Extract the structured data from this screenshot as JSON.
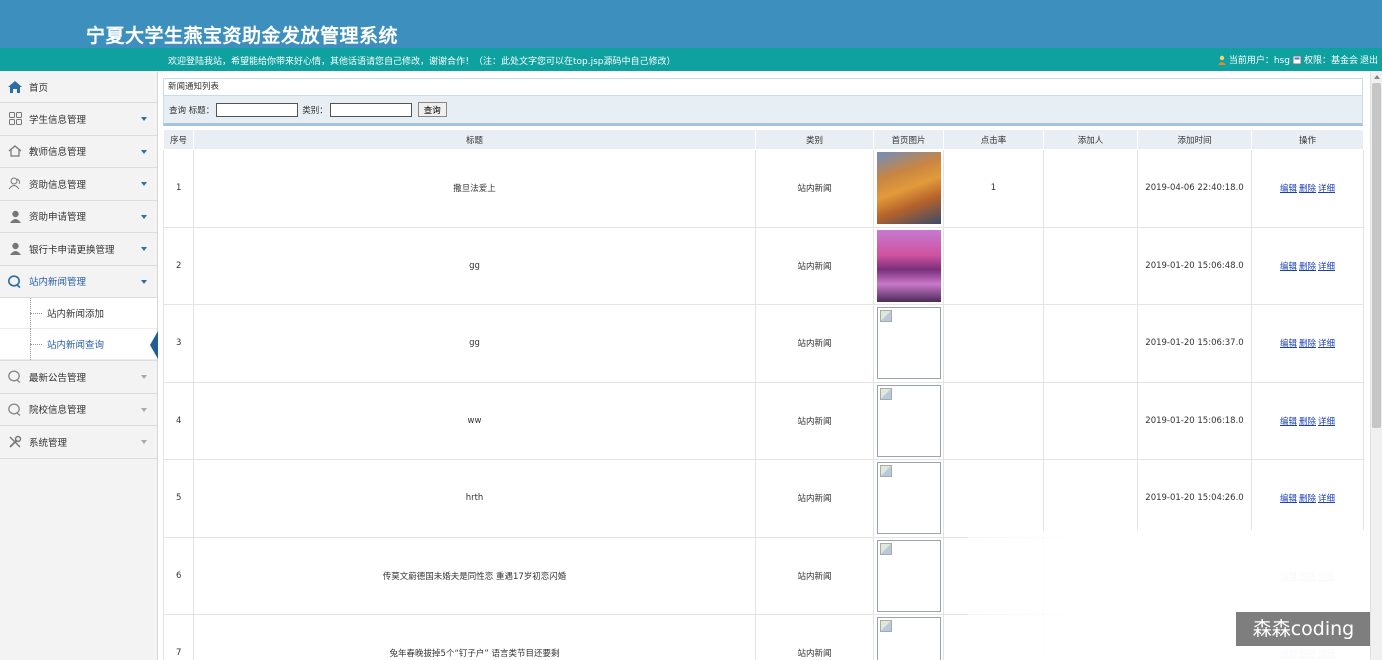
{
  "header": {
    "title": "宁夏大学生燕宝资助金发放管理系统"
  },
  "infobar": {
    "welcome": "欢迎登陆我站，希望能给你带来好心情，其他话语请您自己修改，谢谢合作！（注：此处文字您可以在top.jsp源码中自己修改）",
    "current_user": "当前用户：hsg",
    "role": "权限：基金会",
    "logout": "退出"
  },
  "sidebar": {
    "home": "首页",
    "items": [
      {
        "label": "学生信息管理",
        "icon": "grid-icon"
      },
      {
        "label": "教师信息管理",
        "icon": "house-icon"
      },
      {
        "label": "资助信息管理",
        "icon": "users-icon"
      },
      {
        "label": "资助申请管理",
        "icon": "user-icon"
      },
      {
        "label": "银行卡申请更换管理",
        "icon": "user-icon"
      },
      {
        "label": "站内新闻管理",
        "icon": "chat-icon"
      }
    ],
    "submenu": [
      "站内新闻添加",
      "站内新闻查询"
    ],
    "items_after": [
      {
        "label": "最新公告管理",
        "icon": "chat-icon"
      },
      {
        "label": "院校信息管理",
        "icon": "chat-icon"
      },
      {
        "label": "系统管理",
        "icon": "tools-icon"
      }
    ]
  },
  "main": {
    "list_title": "新闻通知列表",
    "search": {
      "prefix": "查询 标题：",
      "category_label": "类别：",
      "button": "查询",
      "title_value": "",
      "category_value": ""
    },
    "columns": [
      "序号",
      "标题",
      "类别",
      "首页图片",
      "点击率",
      "添加人",
      "添加时间",
      "操作"
    ],
    "rows": [
      {
        "no": "1",
        "title": "撒旦法爱上",
        "category": "站内新闻",
        "image": "mountain-photo",
        "clicks": "1",
        "adder": "",
        "time": "2019-04-06 22:40:18.0"
      },
      {
        "no": "2",
        "title": "gg",
        "category": "站内新闻",
        "image": "lake-photo",
        "clicks": "",
        "adder": "",
        "time": "2019-01-20 15:06:48.0"
      },
      {
        "no": "3",
        "title": "gg",
        "category": "站内新闻",
        "image": "broken-image",
        "clicks": "",
        "adder": "",
        "time": "2019-01-20 15:06:37.0"
      },
      {
        "no": "4",
        "title": "ww",
        "category": "站内新闻",
        "image": "broken-image",
        "clicks": "",
        "adder": "",
        "time": "2019-01-20 15:06:18.0"
      },
      {
        "no": "5",
        "title": "hrth",
        "category": "站内新闻",
        "image": "broken-image",
        "clicks": "",
        "adder": "",
        "time": "2019-01-20 15:04:26.0"
      },
      {
        "no": "6",
        "title": "传莫文蔚德国未婚夫是同性恋 重遇17岁初恋闪婚",
        "category": "站内新闻",
        "image": "broken-image",
        "clicks": "",
        "adder": "",
        "time": ""
      },
      {
        "no": "7",
        "title": "兔年春晚拔掉5个“钉子户” 语言类节目还要剩",
        "category": "站内新闻",
        "image": "broken-image",
        "clicks": "",
        "adder": "",
        "time": ""
      }
    ],
    "actions": {
      "edit": "编辑",
      "delete": "删除",
      "detail": "详细"
    }
  },
  "watermark": "森森coding",
  "colors": {
    "banner": "#3d8fbd",
    "infobar": "#0fa0a0",
    "link": "#1a3fb8",
    "accent": "#1f5f93"
  }
}
